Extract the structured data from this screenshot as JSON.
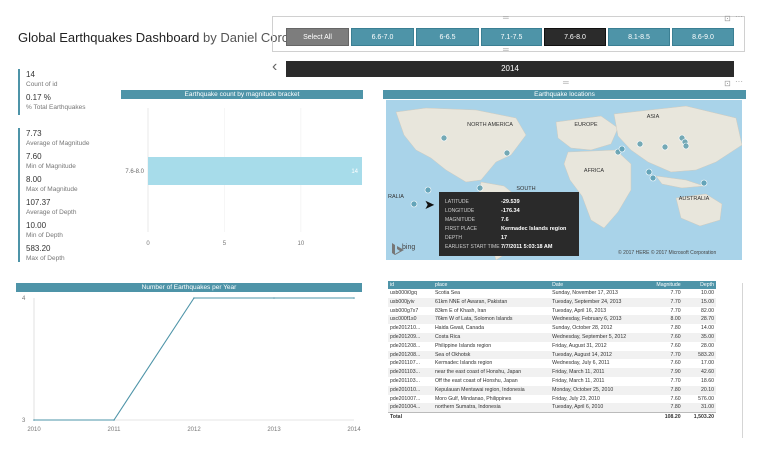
{
  "header": {
    "title": "Global Earthquakes Dashboard",
    "author": "by Daniel Corcoran"
  },
  "slicer": {
    "buttons": [
      "Select All",
      "6.6-7.0",
      "6-6.5",
      "7.1-7.5",
      "7.6-8.0",
      "8.1-8.5",
      "8.6-9.0"
    ],
    "selected": "7.6-8.0"
  },
  "year_slicer": {
    "value": "2014",
    "prev_icon": "chevron-left-icon"
  },
  "kpis": [
    {
      "value": "14",
      "label": "Count of id"
    },
    {
      "value": "0.17 %",
      "label": "% Total Earthquakes"
    },
    {
      "value": "7.73",
      "label": "Average of Magnitude"
    },
    {
      "value": "7.60",
      "label": "Min of Magnitude"
    },
    {
      "value": "8.00",
      "label": "Max of Magnitude"
    },
    {
      "value": "107.37",
      "label": "Average of Depth"
    },
    {
      "value": "10.00",
      "label": "Min of Depth"
    },
    {
      "value": "583.20",
      "label": "Max of Depth"
    }
  ],
  "bracket_chart": {
    "title": "Earthquake count by magnitude bracket"
  },
  "year_chart": {
    "title": "Number of Earthquakes per Year"
  },
  "map": {
    "title": "Earthquake locations",
    "labels": [
      "NORTH AMERICA",
      "EUROPE",
      "ASIA",
      "AFRICA",
      "SOUTH",
      "AUSTRALIA",
      "RALIA"
    ],
    "brand": "bing",
    "copyright": "© 2017 HERE   © 2017 Microsoft Corporation",
    "marker_color": "#4e94a8",
    "tooltip": [
      {
        "k": "LATITUDE",
        "v": "-29.539"
      },
      {
        "k": "LONGITUDE",
        "v": "-176.34"
      },
      {
        "k": "MAGNITUDE",
        "v": "7.6"
      },
      {
        "k": "FIRST PLACE",
        "v": "Kermadec Islands region"
      },
      {
        "k": "DEPTH",
        "v": "17"
      },
      {
        "k": "EARLIEST START TIME",
        "v": "7/7/2011 5:03:18 AM"
      }
    ]
  },
  "table": {
    "columns": [
      "id",
      "place",
      "Date",
      "Magnitude",
      "Depth"
    ],
    "rows": [
      [
        "usb000i0gq",
        "Scotia Sea",
        "Sunday, November 17, 2013",
        "7.70",
        "10.00"
      ],
      [
        "usb000jyiv",
        "61km NNE of Awaran, Pakistan",
        "Tuesday, September 24, 2013",
        "7.70",
        "15.00"
      ],
      [
        "usb000g7x7",
        "83km E of Khash, Iran",
        "Tuesday, April 16, 2013",
        "7.70",
        "82.00"
      ],
      [
        "usc000f1s0",
        "76km W of Lata, Solomon Islands",
        "Wednesday, February 6, 2013",
        "8.00",
        "28.70"
      ],
      [
        "pde201210...",
        "Haida Gwaii, Canada",
        "Sunday, October 28, 2012",
        "7.80",
        "14.00"
      ],
      [
        "pde201209...",
        "Costa Rica",
        "Wednesday, September 5, 2012",
        "7.60",
        "35.00"
      ],
      [
        "pde201208...",
        "Philippine Islands region",
        "Friday, August 31, 2012",
        "7.60",
        "28.00"
      ],
      [
        "pde201208...",
        "Sea of Okhotsk",
        "Tuesday, August 14, 2012",
        "7.70",
        "583.20"
      ],
      [
        "pde201107...",
        "Kermadec Islands region",
        "Wednesday, July 6, 2011",
        "7.60",
        "17.00"
      ],
      [
        "pde201103...",
        "near the east coast of Honshu, Japan",
        "Friday, March 11, 2011",
        "7.90",
        "42.60"
      ],
      [
        "pde201103...",
        "Off the east coast of Honshu, Japan",
        "Friday, March 11, 2011",
        "7.70",
        "18.60"
      ],
      [
        "pde201010...",
        "Kepulauan Mentawai region, Indonesia",
        "Monday, October 25, 2010",
        "7.80",
        "20.10"
      ],
      [
        "pde201007...",
        "Moro Gulf, Mindanao, Philippines",
        "Friday, July 23, 2010",
        "7.60",
        "576.00"
      ],
      [
        "pde201004...",
        "northern Sumatra, Indonesia",
        "Tuesday, April 6, 2010",
        "7.80",
        "31.00"
      ]
    ],
    "total": [
      "Total",
      "",
      "",
      "108.20",
      "1,503.20"
    ]
  },
  "chart_data": [
    {
      "type": "bar",
      "title": "Earthquake count by magnitude bracket",
      "categories": [
        "7.6-8.0"
      ],
      "values": [
        14
      ],
      "x_ticks": [
        0,
        5,
        10
      ],
      "xlim": [
        0,
        14
      ],
      "orientation": "horizontal",
      "color": "#a7dcea"
    },
    {
      "type": "line",
      "title": "Number of Earthquakes per Year",
      "x": [
        2010,
        2011,
        2012,
        2013,
        2014
      ],
      "values": [
        3,
        3,
        4,
        4,
        4
      ],
      "y_ticks": [
        3,
        4
      ],
      "ylim": [
        3,
        4
      ],
      "color": "#4e94a8"
    }
  ]
}
